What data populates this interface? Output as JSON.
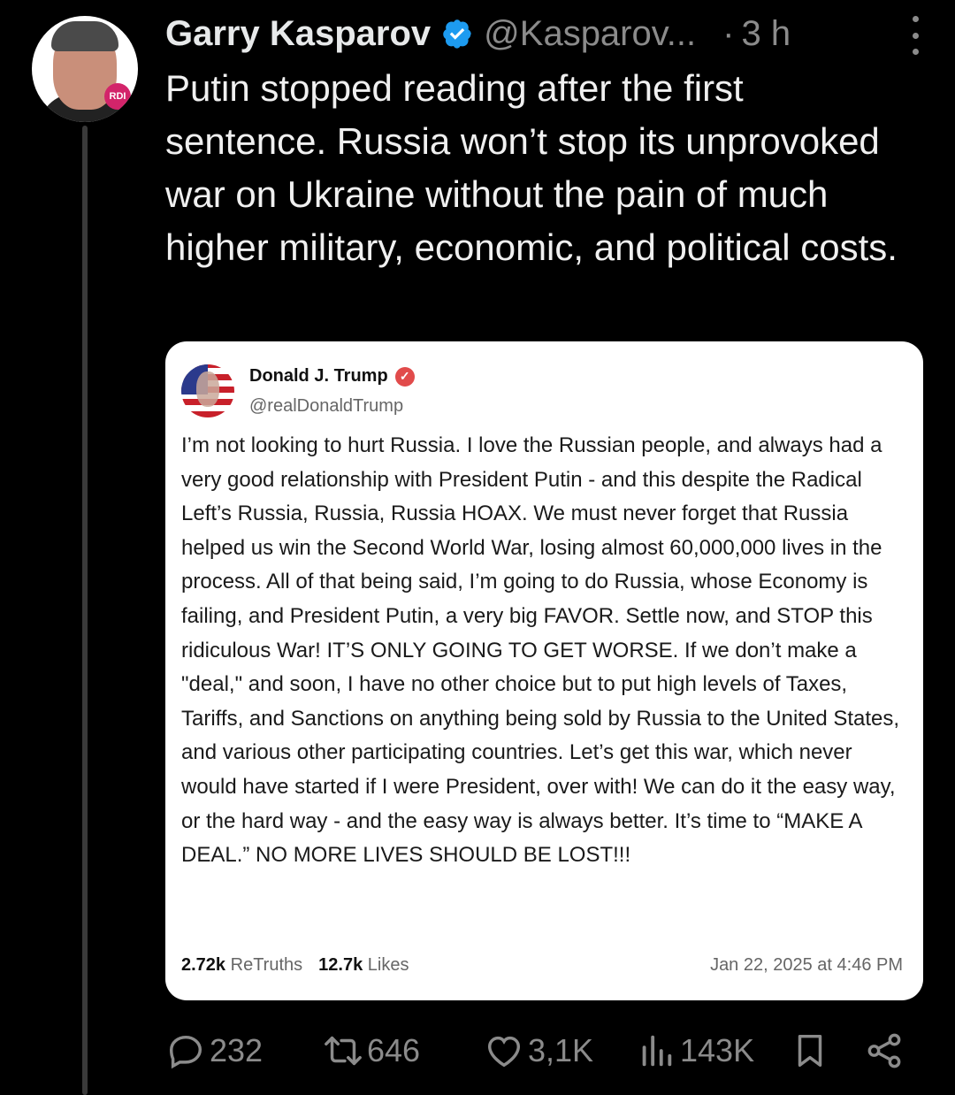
{
  "author": {
    "name": "Garry Kasparov",
    "handle": "@Kasparov...",
    "separator": "·",
    "time": "3 h",
    "avatar_badge": "RDI"
  },
  "tweet": {
    "text": "Putin stopped reading after the first sentence. Russia won’t stop its unprovoked war on Ukraine without the pain of much higher military, economic, and political costs."
  },
  "quoted": {
    "name": "Donald J. Trump",
    "handle": "@realDonaldTrump",
    "verified_glyph": "✓",
    "body": "I’m not looking to hurt Russia. I love the Russian people, and always had a very good relationship with President Putin - and this despite the Radical Left’s Russia, Russia, Russia HOAX. We must never forget that Russia helped us win the Second World War, losing almost 60,000,000 lives in the process. All of that being said, I’m going to do Russia, whose Economy is failing, and President Putin, a very big FAVOR. Settle now, and STOP this ridiculous War! IT’S ONLY GOING TO GET WORSE. If we don’t make a \"deal,\" and soon, I have no other choice but to put high levels of Taxes, Tariffs, and Sanctions on anything being sold by Russia to the United States, and various other participating countries. Let’s get this war, which never would have started if I were President, over with! We can do it the easy way, or the hard way - and the easy way is always better. It’s time to “MAKE A DEAL.” NO MORE LIVES SHOULD BE LOST!!!",
    "retruths_count": "2.72k",
    "retruths_label": "ReTruths",
    "likes_count": "12.7k",
    "likes_label": "Likes",
    "date": "Jan 22, 2025 at 4:46 PM"
  },
  "actions": {
    "replies": "232",
    "reposts": "646",
    "likes": "3,1K",
    "views": "143K"
  },
  "icons": [
    "verified-badge-icon",
    "more-icon",
    "reply-icon",
    "repost-icon",
    "like-icon",
    "views-icon",
    "bookmark-icon",
    "share-icon"
  ],
  "colors": {
    "background": "#000000",
    "verified": "#1d9bf0",
    "muted": "#8b8b8b",
    "card_verified": "#e14b4b"
  }
}
